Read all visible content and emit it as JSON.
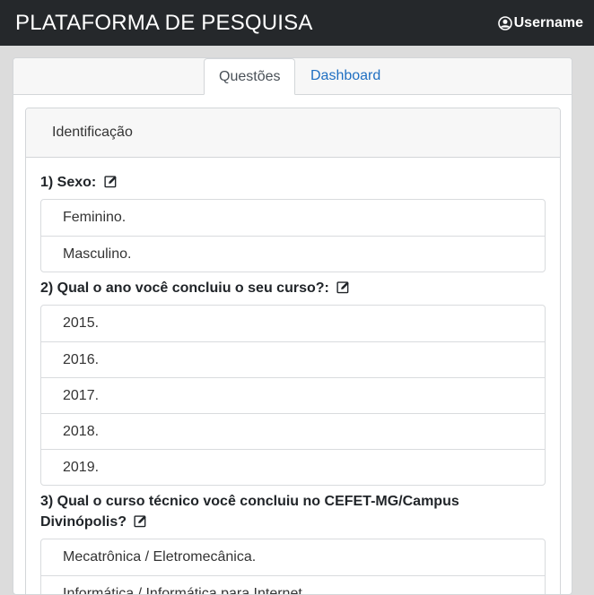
{
  "navbar": {
    "brand": "PLATAFORMA DE PESQUISA",
    "username": "Username"
  },
  "tabs": [
    {
      "label": "Questões",
      "active": true
    },
    {
      "label": "Dashboard",
      "active": false
    }
  ],
  "section": {
    "title": "Identificação"
  },
  "questions": [
    {
      "title": "1) Sexo:",
      "options": [
        "Feminino.",
        "Masculino."
      ]
    },
    {
      "title": "2) Qual o ano você concluiu o seu curso?:",
      "options": [
        "2015.",
        "2016.",
        "2017.",
        "2018.",
        "2019."
      ]
    },
    {
      "title": "3) Qual o curso técnico você concluiu no CEFET-MG/Campus Divinópolis?",
      "options": [
        "Mecatrônica / Eletromecânica.",
        "Informática / Informática para Internet."
      ]
    }
  ],
  "colors": {
    "navbar_bg": "#25282b",
    "link": "#1f6fc2",
    "page_bg": "#dcdcdc"
  },
  "icons": {
    "user": "user-circle-icon",
    "edit": "edit-square-icon"
  }
}
